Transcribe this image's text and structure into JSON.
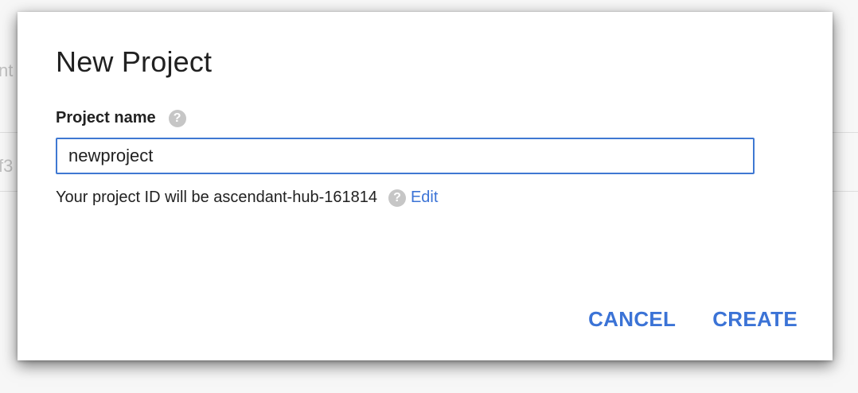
{
  "background": {
    "fragment_1": "nt",
    "fragment_2": "f3"
  },
  "dialog": {
    "title": "New Project",
    "field": {
      "label": "Project name",
      "help_icon": "help-circle-icon",
      "value": "newproject"
    },
    "project_id": {
      "text": "Your project ID will be ascendant-hub-161814",
      "help_icon": "help-circle-icon",
      "edit_label": "Edit"
    },
    "actions": {
      "cancel_label": "CANCEL",
      "create_label": "CREATE"
    }
  },
  "colors": {
    "accent": "#3b73d6",
    "input_border": "#3f78d2",
    "help_icon_bg": "#c6c6c6",
    "text": "#212121"
  }
}
